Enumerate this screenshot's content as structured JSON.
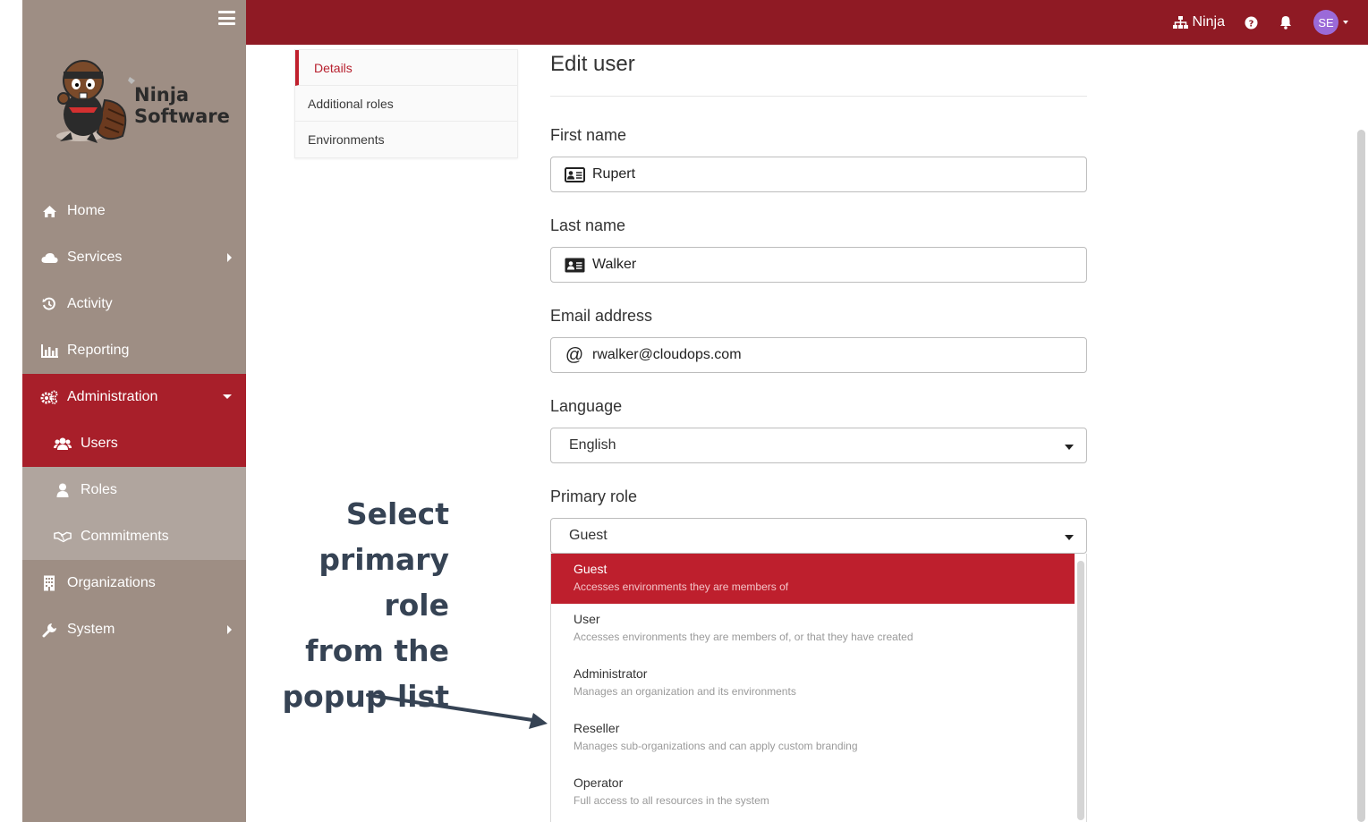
{
  "app": {
    "logo_text_line1": "Ninja",
    "logo_text_line2": "Software",
    "brand_color": "#8f1a24",
    "accent_color": "#be1f2d"
  },
  "sidebar": {
    "items": [
      {
        "label": "Home",
        "icon": "home-icon"
      },
      {
        "label": "Services",
        "icon": "cloud-icon"
      },
      {
        "label": "Activity",
        "icon": "history-icon"
      },
      {
        "label": "Reporting",
        "icon": "bar-chart-icon"
      },
      {
        "label": "Administration",
        "icon": "cogs-icon"
      },
      {
        "label": "Users",
        "icon": "users-icon"
      },
      {
        "label": "Roles",
        "icon": "user-icon"
      },
      {
        "label": "Commitments",
        "icon": "handshake-icon"
      },
      {
        "label": "Organizations",
        "icon": "building-icon"
      },
      {
        "label": "System",
        "icon": "wrench-icon"
      }
    ]
  },
  "topbar": {
    "org_name": "Ninja",
    "avatar_initials": "SE"
  },
  "tabs": [
    {
      "label": "Details"
    },
    {
      "label": "Additional roles"
    },
    {
      "label": "Environments"
    }
  ],
  "form": {
    "title": "Edit user",
    "first_name": {
      "label": "First name",
      "value": "Rupert"
    },
    "last_name": {
      "label": "Last name",
      "value": "Walker"
    },
    "email": {
      "label": "Email address",
      "value": "rwalker@cloudops.com",
      "icon_glyph": "@"
    },
    "language": {
      "label": "Language",
      "value": "English"
    },
    "primary_role": {
      "label": "Primary role",
      "value": "Guest"
    }
  },
  "role_options": [
    {
      "name": "Guest",
      "desc": "Accesses environments they are members of"
    },
    {
      "name": "User",
      "desc": "Accesses environments they are members of, or that they have created"
    },
    {
      "name": "Administrator",
      "desc": "Manages an organization and its environments"
    },
    {
      "name": "Reseller",
      "desc": "Manages sub-organizations and can apply custom branding"
    },
    {
      "name": "Operator",
      "desc": "Full access to all resources in the system"
    }
  ],
  "callout": {
    "line1": "Select",
    "line2": "primary role",
    "line3": "from the",
    "line4": "popup list"
  }
}
